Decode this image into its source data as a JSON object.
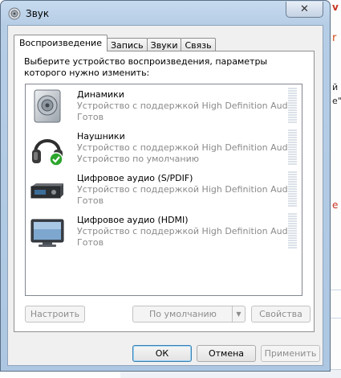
{
  "window": {
    "title": "Звук",
    "close_glyph": "✕"
  },
  "tabs": [
    {
      "label": "Воспроизведение",
      "active": true
    },
    {
      "label": "Запись",
      "active": false
    },
    {
      "label": "Звуки",
      "active": false
    },
    {
      "label": "Связь",
      "active": false
    }
  ],
  "playback": {
    "prompt": "Выберите устройство воспроизведения, параметры которого нужно изменить:",
    "devices": [
      {
        "name": "Динамики",
        "description": "Устройство с поддержкой High Definition Audio",
        "status": "Готов",
        "icon": "speaker-icon"
      },
      {
        "name": "Наушники",
        "description": "Устройство с поддержкой High Definition Audio",
        "status": "Устройство по умолчанию",
        "icon": "headphones-icon",
        "default": true
      },
      {
        "name": "Цифровое аудио (S/PDIF)",
        "description": "Устройство с поддержкой High Definition Audio",
        "status": "Готов",
        "icon": "spdif-receiver-icon"
      },
      {
        "name": "Цифровое аудио (HDMI)",
        "description": "Устройство с поддержкой High Definition Audio",
        "status": "Готов",
        "icon": "hdmi-monitor-icon"
      }
    ],
    "buttons": {
      "configure": "Настроить",
      "set_default": "По умолчанию",
      "properties": "Свойства"
    }
  },
  "footer": {
    "ok": "ОК",
    "cancel": "Отмена",
    "apply": "Применить"
  },
  "background": {
    "char_v": "v",
    "char_r": "r",
    "chars": [
      "й",
      "е\""
    ],
    "char_e": "е"
  }
}
